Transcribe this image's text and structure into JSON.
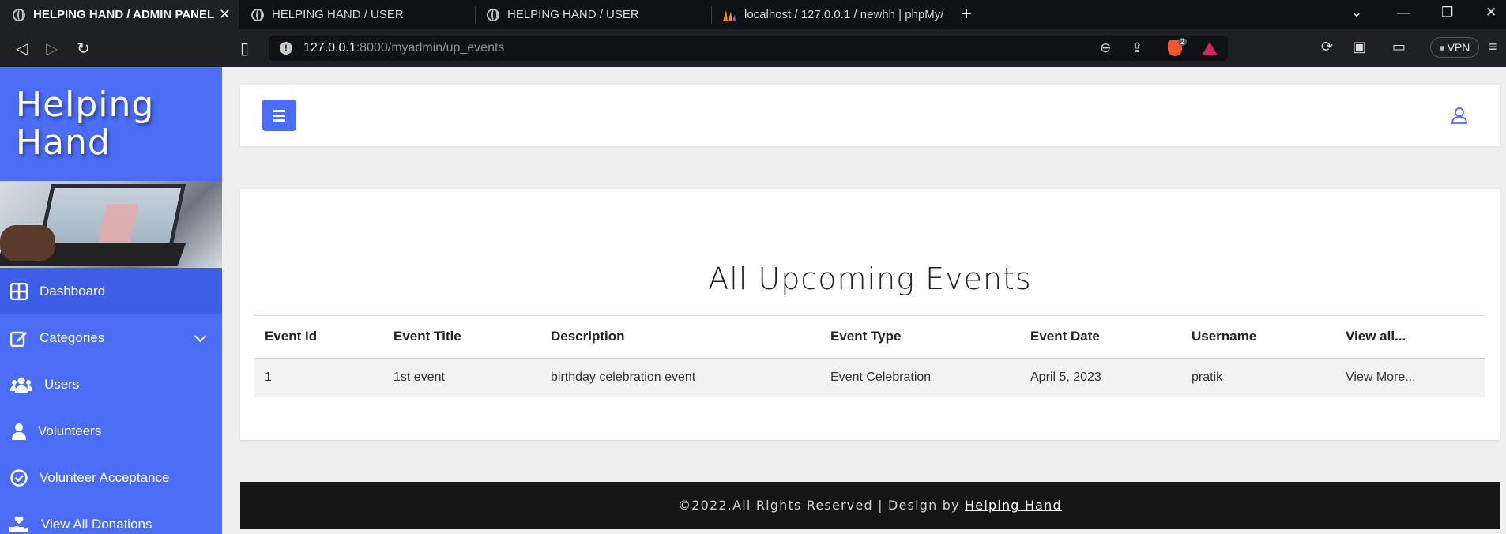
{
  "browser": {
    "tabs": [
      {
        "title": "HELPING HAND / ADMIN PANEL",
        "active": true
      },
      {
        "title": "HELPING HAND / USER",
        "active": false
      },
      {
        "title": "HELPING HAND / USER",
        "active": false
      },
      {
        "title": "localhost / 127.0.0.1 / newhh | phpMy/",
        "active": false
      }
    ],
    "url_host": "127.0.0.1",
    "url_path": ":8000/myadmin/up_events",
    "brave_badge": "2",
    "vpn_label": "VPN"
  },
  "sidebar": {
    "brand_line1": "Helping",
    "brand_line2": "Hand",
    "items": [
      {
        "label": "Dashboard",
        "icon": "dashboard-icon",
        "active": true
      },
      {
        "label": "Categories",
        "icon": "edit-icon",
        "has_submenu": true
      },
      {
        "label": "Users",
        "icon": "users-icon"
      },
      {
        "label": "Volunteers",
        "icon": "user-icon"
      },
      {
        "label": "Volunteer Acceptance",
        "icon": "check-circle-icon"
      },
      {
        "label": "View All Donations",
        "icon": "donation-icon"
      }
    ]
  },
  "main": {
    "title": "All Upcoming Events",
    "table": {
      "headers": [
        "Event Id",
        "Event Title",
        "Description",
        "Event Type",
        "Event Date",
        "Username",
        "View all..."
      ],
      "rows": [
        [
          "1",
          "1st event",
          "birthday celebration event",
          "Event Celebration",
          "April 5, 2023",
          "pratik",
          "View More..."
        ]
      ]
    }
  },
  "footer": {
    "text": "©2022.All Rights Reserved | Design by ",
    "link": "Helping Hand"
  },
  "colors": {
    "accent": "#4b6cf5",
    "sidebar_active": "#3e5ee8",
    "footer_bg": "#151515"
  }
}
